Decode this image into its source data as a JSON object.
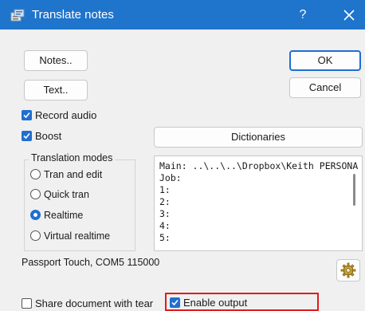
{
  "window": {
    "title": "Translate notes",
    "help_label": "?",
    "icons": {
      "app": "translate-notes-app-icon",
      "close": "close-icon"
    }
  },
  "buttons": {
    "notes": "Notes..",
    "text": "Text..",
    "ok": "OK",
    "cancel": "Cancel",
    "dictionaries": "Dictionaries"
  },
  "checkboxes": {
    "record_audio": {
      "label": "Record audio",
      "checked": true
    },
    "boost": {
      "label": "Boost",
      "checked": true
    },
    "share_document": {
      "label": "Share document with tear",
      "checked": false
    },
    "enable_output": {
      "label": "Enable output",
      "checked": true
    }
  },
  "translation_modes": {
    "label": "Translation modes",
    "options": [
      {
        "label": "Tran and edit",
        "selected": false
      },
      {
        "label": "Quick tran",
        "selected": false
      },
      {
        "label": "Realtime",
        "selected": true
      },
      {
        "label": "Virtual realtime",
        "selected": false
      }
    ]
  },
  "dictionary_list": {
    "lines": [
      "Main: ..\\..\\..\\Dropbox\\Keith PERSONA",
      "Job:",
      "1:",
      "2:",
      "3:",
      "4:",
      "5:"
    ]
  },
  "status": {
    "device": "Passport Touch, COM5 115000"
  },
  "settings_button": {
    "icon": "settings-gear-icon"
  },
  "colors": {
    "titlebar": "#1f74cc",
    "accent": "#1f6fd0",
    "dialog_bg": "#f0f0f0",
    "highlight": "#e11b1b"
  }
}
